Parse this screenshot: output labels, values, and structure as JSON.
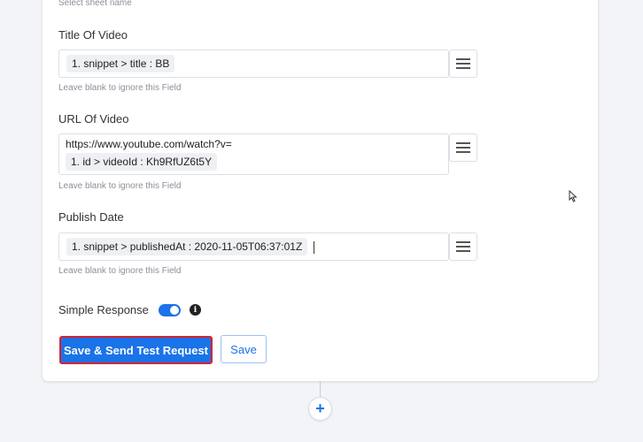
{
  "sheet": {
    "hint": "Select sheet name"
  },
  "title_field": {
    "label": "Title Of Video",
    "chip": "1. snippet > title : BB",
    "hint": "Leave blank to ignore this Field"
  },
  "url_field": {
    "label": "URL Of Video",
    "prefix": "https://www.youtube.com/watch?v=",
    "chip": "1. id > videoId : Kh9RfUZ6t5Y",
    "hint": "Leave blank to ignore this Field"
  },
  "date_field": {
    "label": "Publish Date",
    "chip": "1. snippet > publishedAt : 2020-11-05T06:37:01Z",
    "hint": "Leave blank to ignore this Field"
  },
  "simple_response": {
    "label": "Simple Response",
    "enabled": true,
    "info_icon": "info-icon"
  },
  "buttons": {
    "save_send": "Save & Send Test Request",
    "save": "Save",
    "add": "+"
  },
  "colors": {
    "accent": "#1a73e8",
    "highlight": "#d8232a"
  }
}
